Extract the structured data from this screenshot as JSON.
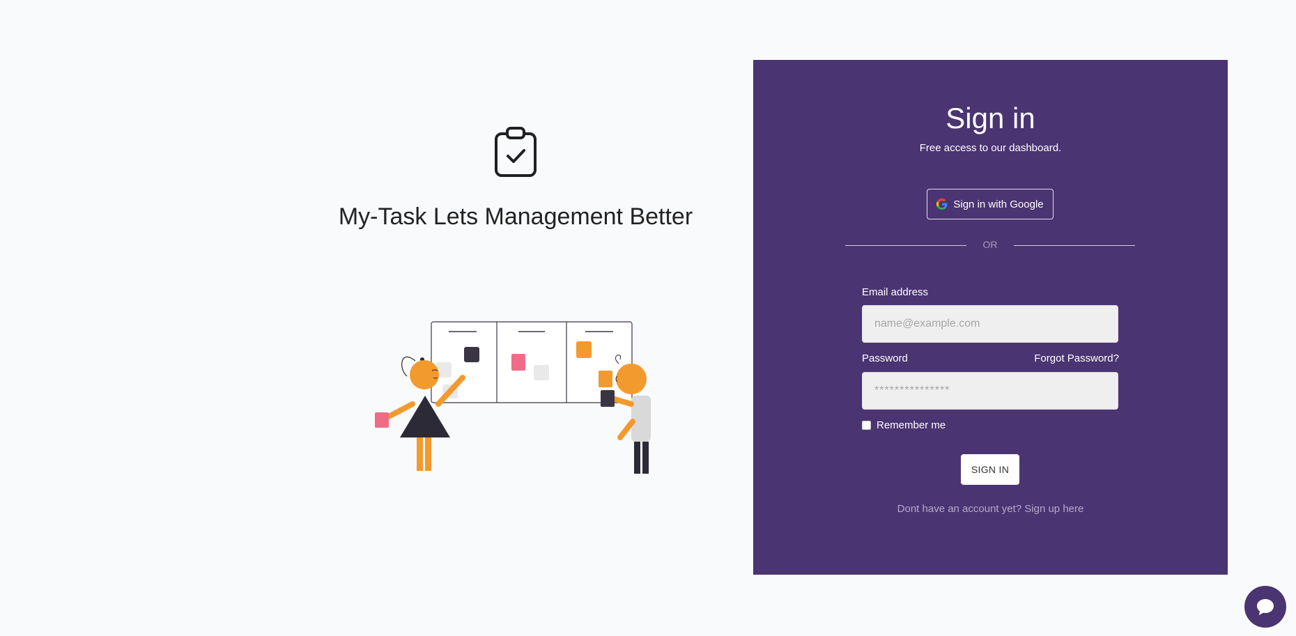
{
  "brand": {
    "title": "My-Task Lets Management Better",
    "logo_icon": "clipboard-check-icon"
  },
  "signin": {
    "title": "Sign in",
    "subtitle": "Free access to our dashboard.",
    "google_label": "Sign in with Google",
    "divider_text": "OR",
    "email_label": "Email address",
    "email_placeholder": "name@example.com",
    "password_label": "Password",
    "forgot_label": "Forgot Password?",
    "password_placeholder": "***************",
    "remember_label": "Remember me",
    "submit_label": "SIGN IN",
    "signup_text": "Dont have an account yet? Sign up here"
  },
  "chat": {
    "icon": "chat-bubble-icon"
  },
  "colors": {
    "primary": "#4b3472",
    "accent_orange": "#f39a2e",
    "accent_pink": "#f06b86",
    "dark": "#3a3545"
  }
}
